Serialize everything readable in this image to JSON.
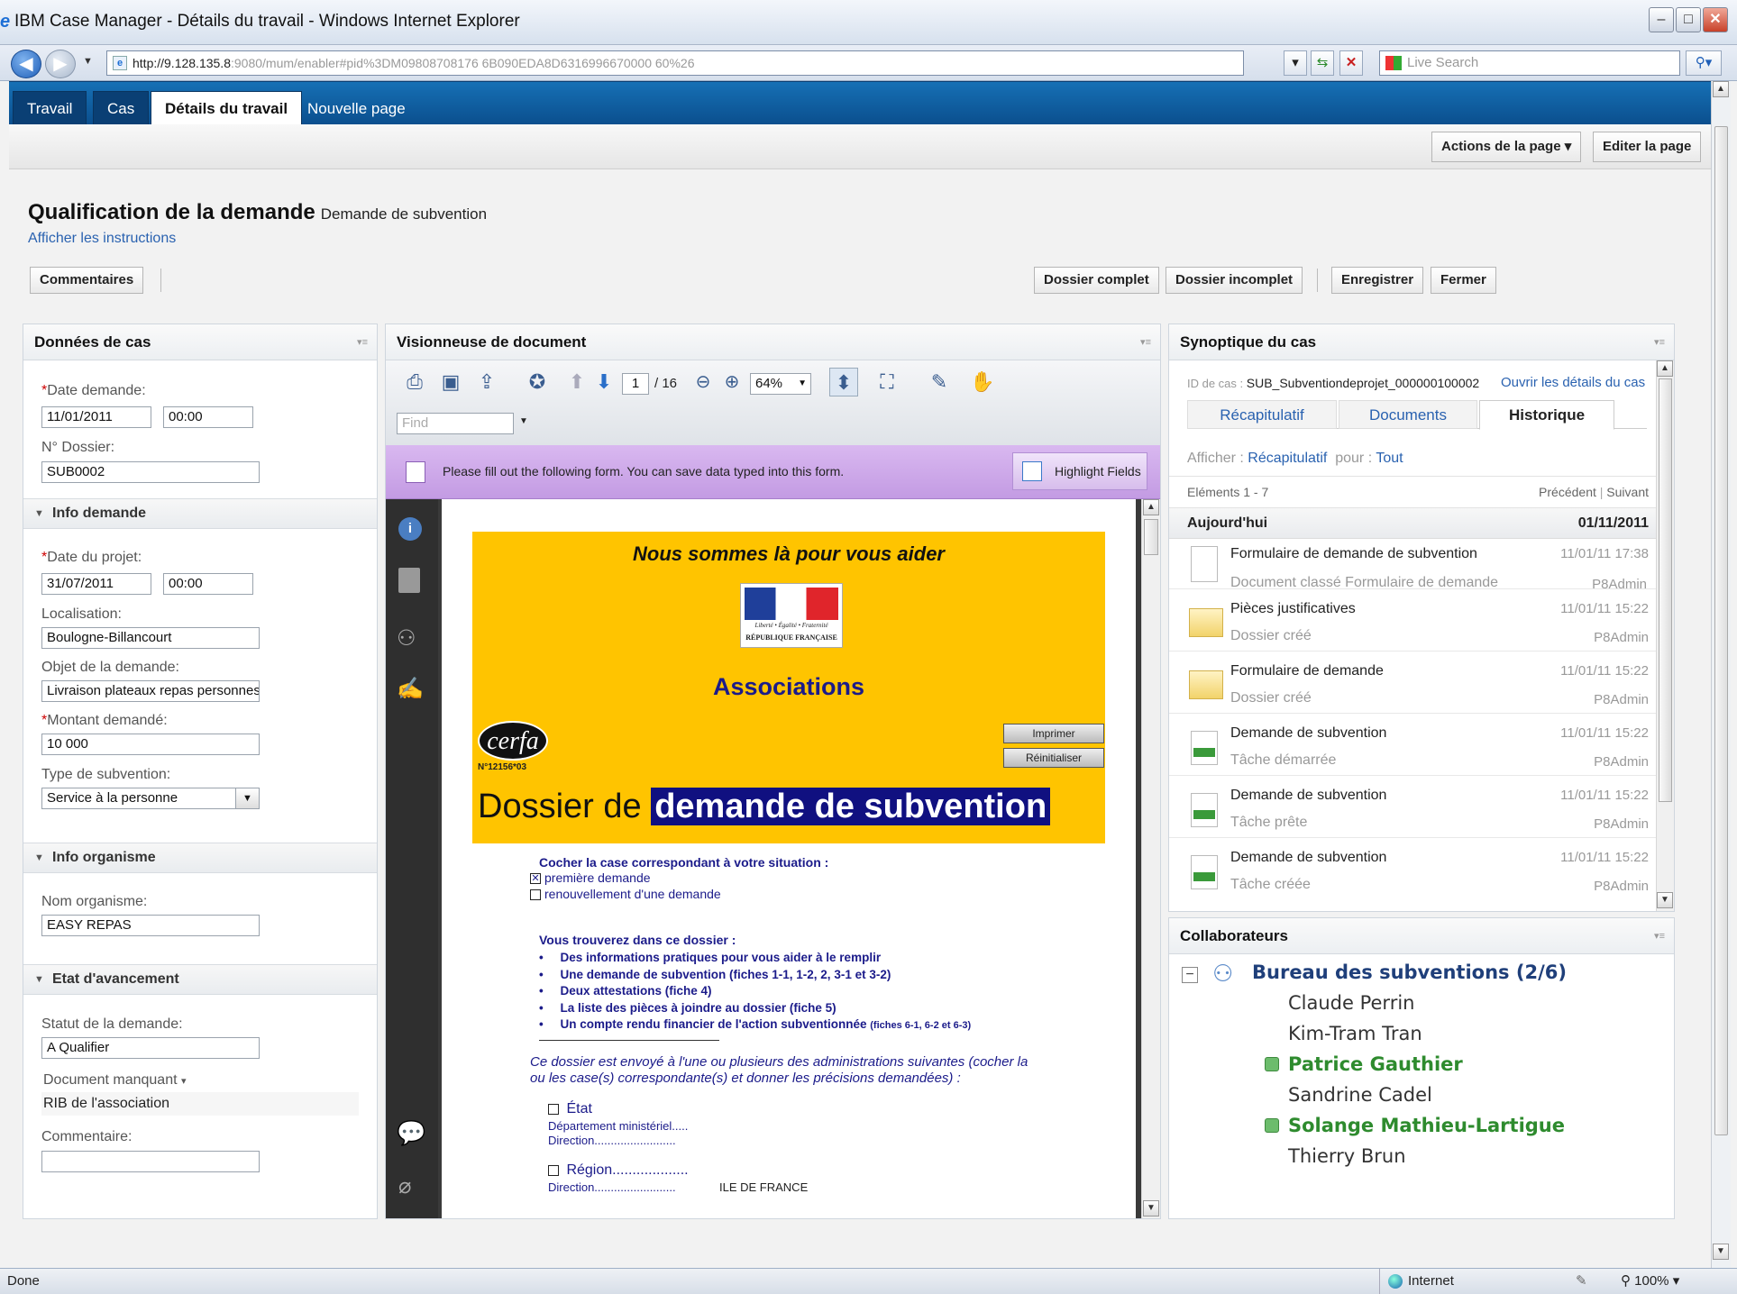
{
  "window": {
    "title": "IBM Case Manager - Détails du travail - Windows Internet Explorer",
    "min": "–",
    "max": "□",
    "close": "✕"
  },
  "address": {
    "url_host": "http://9.128.135.8",
    "url_rest": ":9080/mum/enabler#pid%3DM09808708176 6B090EDA8D6316996670000 60%26",
    "search_placeholder": "Live Search"
  },
  "tabs": [
    {
      "label": "Travail"
    },
    {
      "label": "Cas"
    },
    {
      "label": "Détails du travail"
    },
    {
      "label": "Nouvelle page"
    }
  ],
  "page_actions": {
    "actions": "Actions de la page",
    "edit": "Editer la page"
  },
  "header": {
    "title": "Qualification de la demande",
    "subtitle": "Demande de subvention",
    "instructions": "Afficher les instructions"
  },
  "buttons": {
    "comments": "Commentaires",
    "complete": "Dossier complet",
    "incomplete": "Dossier incomplet",
    "save": "Enregistrer",
    "close": "Fermer"
  },
  "case_data": {
    "title": "Données de cas",
    "date_label": "Date demande:",
    "date_value": "11/01/2011",
    "time_value": "00:00",
    "dossier_label": "N° Dossier:",
    "dossier_value": "SUB0002",
    "section_info": "Info demande",
    "project_date_label": "Date du projet:",
    "project_date_value": "31/07/2011",
    "project_time_value": "00:00",
    "location_label": "Localisation:",
    "location_value": "Boulogne-Billancourt",
    "object_label": "Objet de la demande:",
    "object_value": "Livraison plateaux repas personnes ag",
    "amount_label": "Montant demandé:",
    "amount_value": "10 000",
    "type_label": "Type de subvention:",
    "type_value": "Service à la personne",
    "section_org": "Info organisme",
    "org_label": "Nom organisme:",
    "org_value": "EASY REPAS",
    "section_state": "Etat d'avancement",
    "status_label": "Statut de la demande:",
    "status_value": "A Qualifier",
    "missing_label": "Document manquant",
    "missing_value": "RIB de l'association",
    "comment_label": "Commentaire:"
  },
  "viewer": {
    "title": "Visionneuse de document",
    "page_current": "1",
    "page_total": "/ 16",
    "zoom": "64%",
    "find_placeholder": "Find",
    "banner": "Please fill out the following form. You can save data typed into this form.",
    "highlight": "Highlight Fields",
    "doc": {
      "help": "Nous sommes là pour vous aider",
      "rf_line1": "Liberté • Égalité • Fraternité",
      "rf_line2": "RÉPUBLIQUE FRANÇAISE",
      "associations": "Associations",
      "cerfa": "cerfa",
      "cerfa_num": "N°12156*03",
      "print": "Imprimer",
      "reset": "Réinitialiser",
      "dossier": "Dossier de",
      "dossier_hl": "demande de subvention",
      "check_title": "Cocher la case correspondant à votre situation :",
      "check1": "première demande",
      "check2": "renouvellement d'une demande",
      "find_title": "Vous trouverez dans ce dossier :",
      "bullets": [
        "Des informations pratiques pour vous aider à le remplir",
        "Une demande de subvention (fiches 1-1, 1-2, 2, 3-1 et 3-2)",
        "Deux attestations (fiche 4)",
        "La liste des pièces à joindre au dossier (fiche 5)",
        "Un compte rendu financier de l'action subventionnée"
      ],
      "bullet5_small": "(fiches 6-1, 6-2 et 6-3)",
      "italic1": "Ce dossier est envoyé à l'une ou plusieurs des administrations suivantes (cocher la",
      "italic2": "ou les case(s) correspondante(s) et donner les précisions demandées) :",
      "etat": "État",
      "dept": "Département ministériel.....",
      "direction1": "Direction.........................",
      "region": "Région...................",
      "direction2": "Direction.........................",
      "ile": "ILE DE FRANCE"
    }
  },
  "synoptic": {
    "title": "Synoptique du cas",
    "case_id_label": "ID de cas :",
    "case_id": "SUB_Subventiondeprojet_000000100002",
    "open_details": "Ouvrir les détails du cas",
    "tabs": [
      "Récapitulatif",
      "Documents",
      "Historique"
    ],
    "show_label": "Afficher :",
    "show_value": "Récapitulatif",
    "for_label": "pour :",
    "for_value": "Tout",
    "elements": "Eléments 1 - 7",
    "prev": "Précédent",
    "sep": "|",
    "next": "Suivant",
    "today": "Aujourd'hui",
    "today_date": "01/11/2011",
    "rows": [
      {
        "title": "Formulaire de demande de subvention",
        "date": "11/01/11 17:38",
        "sub": "Document classé Formulaire de demande",
        "user": "P8Admin",
        "icon": "document-icon"
      },
      {
        "title": "Pièces justificatives",
        "date": "11/01/11 15:22",
        "sub": "Dossier créé",
        "user": "P8Admin",
        "icon": "folder-icon"
      },
      {
        "title": "Formulaire de demande",
        "date": "11/01/11 15:22",
        "sub": "Dossier créé",
        "user": "P8Admin",
        "icon": "folder-icon"
      },
      {
        "title": "Demande de subvention",
        "date": "11/01/11 15:22",
        "sub": "Tâche démarrée",
        "user": "P8Admin",
        "icon": "task-icon"
      },
      {
        "title": "Demande de subvention",
        "date": "11/01/11 15:22",
        "sub": "Tâche prête",
        "user": "P8Admin",
        "icon": "task-icon"
      },
      {
        "title": "Demande de subvention",
        "date": "11/01/11 15:22",
        "sub": "Tâche créée",
        "user": "P8Admin",
        "icon": "task-icon"
      }
    ]
  },
  "collaborators": {
    "title": "Collaborateurs",
    "group": "Bureau des subventions (2/6)",
    "people": [
      {
        "name": "Claude Perrin",
        "online": false
      },
      {
        "name": "Kim-Tram Tran",
        "online": false
      },
      {
        "name": "Patrice Gauthier",
        "online": true
      },
      {
        "name": "Sandrine Cadel",
        "online": false
      },
      {
        "name": "Solange Mathieu-Lartigue",
        "online": true
      },
      {
        "name": "Thierry Brun",
        "online": false
      }
    ]
  },
  "status": {
    "left": "Done",
    "zone": "Internet",
    "zoom": "100%"
  }
}
